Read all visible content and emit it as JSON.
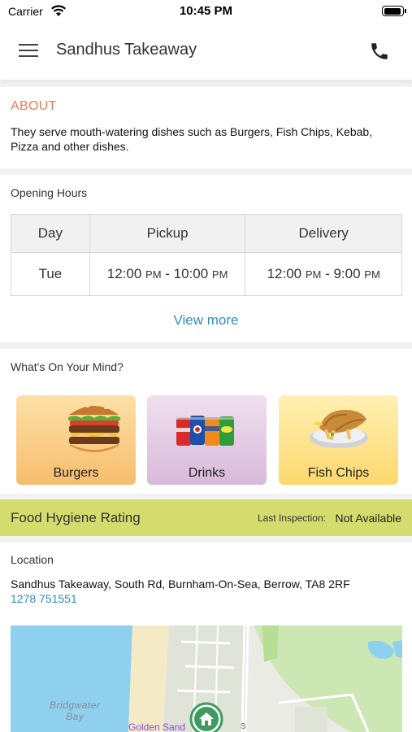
{
  "status_bar": {
    "carrier": "Carrier",
    "time": "10:45 PM"
  },
  "header": {
    "title": "Sandhus Takeaway"
  },
  "about": {
    "heading": "ABOUT",
    "text": "They serve mouth-watering dishes such as Burgers, Fish  Chips, Kebab, Pizza and other dishes."
  },
  "opening_hours": {
    "label": "Opening Hours",
    "columns": [
      "Day",
      "Pickup",
      "Delivery"
    ],
    "rows": [
      {
        "day": "Tue",
        "pickup_start": "12:00",
        "pickup_start_ampm": "PM",
        "pickup_end": "10:00",
        "pickup_end_ampm": "PM",
        "delivery_start": "12:00",
        "delivery_start_ampm": "PM",
        "delivery_end": "9:00",
        "delivery_end_ampm": "PM"
      }
    ],
    "view_more": "View more"
  },
  "whats_on_your_mind": {
    "label": "What's On Your Mind?",
    "categories": [
      {
        "label": "Burgers",
        "icon": "burger-icon"
      },
      {
        "label": "Drinks",
        "icon": "soda-cans-icon"
      },
      {
        "label": "Fish  Chips",
        "icon": "fish-and-chips-icon"
      }
    ]
  },
  "hygiene": {
    "title": "Food Hygiene Rating",
    "inspection_label": "Last Inspection:",
    "inspection_value": "Not Available"
  },
  "location": {
    "label": "Location",
    "address": "Sandhus Takeaway, South Rd, Burnham-On-Sea, Berrow, TA8 2RF",
    "phone": "1278 751551",
    "map": {
      "water_label_line1": "Bridgwater",
      "water_label_line2": "Bay",
      "place_label": "Golden Sand",
      "road_label": "S"
    }
  },
  "colors": {
    "accent_orange": "#ef7a52",
    "link_blue": "#2e8fb8",
    "hygiene_bar": "#d5dc6e"
  }
}
